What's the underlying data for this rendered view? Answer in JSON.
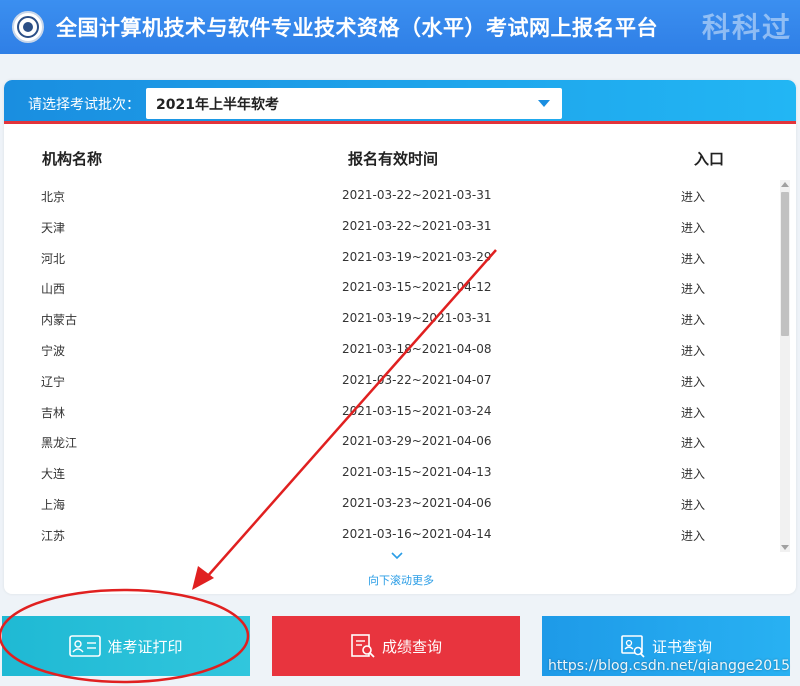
{
  "header": {
    "title": "全国计算机技术与软件专业技术资格（水平）考试网上报名平台",
    "watermark": "科科过"
  },
  "batch": {
    "label": "请选择考试批次：",
    "selected": "2021年上半年软考"
  },
  "table": {
    "columns": [
      "机构名称",
      "报名有效时间",
      "入口"
    ],
    "rows": [
      {
        "name": "北京",
        "time": "2021-03-22~2021-03-31",
        "entry": "进入"
      },
      {
        "name": "天津",
        "time": "2021-03-22~2021-03-31",
        "entry": "进入"
      },
      {
        "name": "河北",
        "time": "2021-03-19~2021-03-29",
        "entry": "进入"
      },
      {
        "name": "山西",
        "time": "2021-03-15~2021-04-12",
        "entry": "进入"
      },
      {
        "name": "内蒙古",
        "time": "2021-03-19~2021-03-31",
        "entry": "进入"
      },
      {
        "name": "宁波",
        "time": "2021-03-18~2021-04-08",
        "entry": "进入"
      },
      {
        "name": "辽宁",
        "time": "2021-03-22~2021-04-07",
        "entry": "进入"
      },
      {
        "name": "吉林",
        "time": "2021-03-15~2021-03-24",
        "entry": "进入"
      },
      {
        "name": "黑龙江",
        "time": "2021-03-29~2021-04-06",
        "entry": "进入"
      },
      {
        "name": "大连",
        "time": "2021-03-15~2021-04-13",
        "entry": "进入"
      },
      {
        "name": "上海",
        "time": "2021-03-23~2021-04-06",
        "entry": "进入"
      },
      {
        "name": "江苏",
        "time": "2021-03-16~2021-04-14",
        "entry": "进入"
      }
    ]
  },
  "scroll_more": "向下滚动更多",
  "buttons": {
    "print": "准考证打印",
    "score": "成绩查询",
    "cert": "证书查询"
  },
  "watermark_url": "https://blog.csdn.net/qiangge2015",
  "colors": {
    "header": "#3b8ff0",
    "bar": "#1a8ee0",
    "accent_red": "#e8343e",
    "print_btn": "#1fb9d4",
    "cert_btn": "#1e9ae8",
    "annotation_red": "#e02020"
  }
}
